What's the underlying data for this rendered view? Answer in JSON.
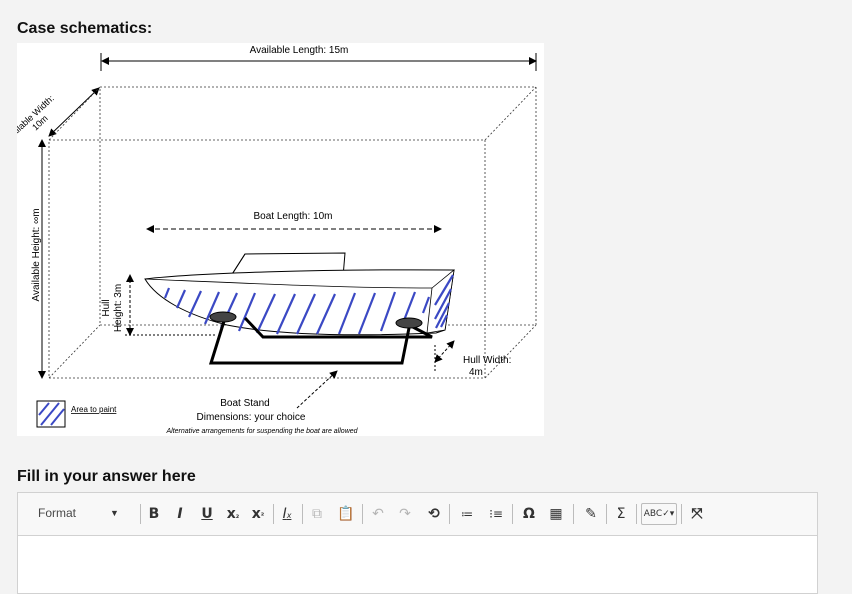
{
  "case_heading": "Case schematics:",
  "answer_heading": "Fill in your answer here",
  "schematic": {
    "available_length": "Available Length: 15m",
    "available_width_line1": "Available Width:",
    "available_width_line2": "10m",
    "available_height": "Available Height: ∞m",
    "boat_length": "Boat Length: 10m",
    "hull_height_line1": "Hull",
    "hull_height_line2": "Height: 3m",
    "hull_width_line1": "Hull Width:",
    "hull_width_line2": "4m",
    "legend_label": "Area to paint",
    "boat_stand": "Boat Stand",
    "dimensions": "Dimensions: your choice",
    "note": "Alternative arrangements for suspending the boat are allowed",
    "paint_color": "#3b49c4"
  },
  "editor": {
    "format_label": "Format",
    "toolbar_icons": [
      "bold-icon",
      "italic-icon",
      "underline-icon",
      "subscript-icon",
      "superscript-icon",
      "remove-format-icon",
      "copy-icon",
      "paste-icon",
      "undo-icon",
      "redo-icon",
      "history-icon",
      "numbered-list-icon",
      "bulleted-list-icon",
      "special-char-icon",
      "table-icon",
      "pencil-icon",
      "sigma-icon",
      "spellcheck-icon",
      "maximize-icon"
    ],
    "content": ""
  }
}
